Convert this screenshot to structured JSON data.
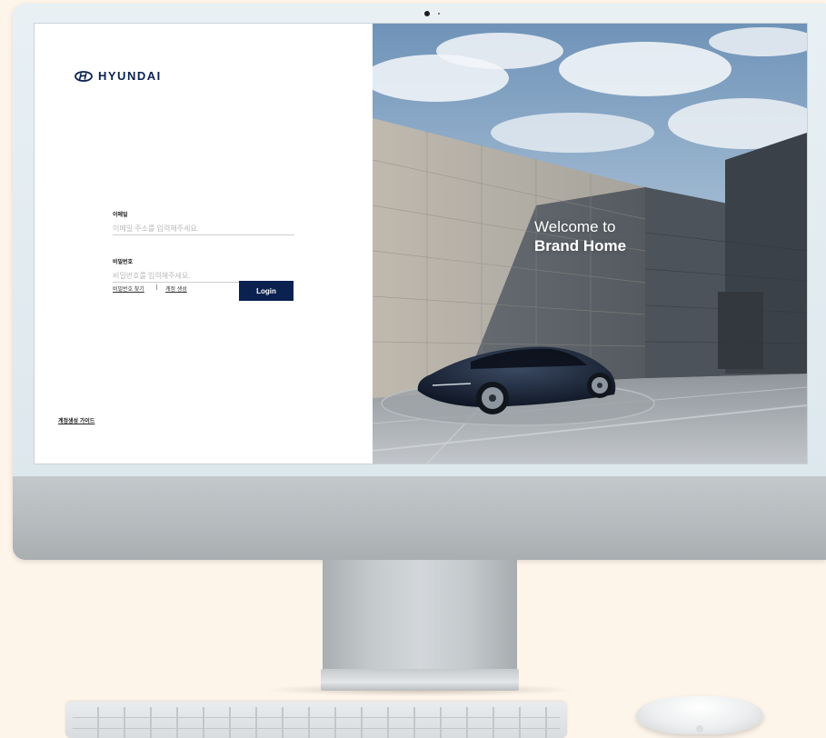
{
  "brand": {
    "name": "HYUNDAI",
    "logo_icon": "hyundai-emblem-icon",
    "color": "#0b2250"
  },
  "login_form": {
    "email_label": "이메일",
    "email_placeholder": "이메일 주소를 입력해주세요.",
    "password_label": "비밀번호",
    "password_placeholder": "비밀번호를 입력해주세요.",
    "find_password_link": "비밀번호 찾기",
    "create_account_link": "계정 생성",
    "login_button": "Login",
    "account_guide_link": "계정생성 가이드"
  },
  "hero": {
    "line1": "Welcome to",
    "line2": "Brand Home"
  },
  "colors": {
    "background": "#fdf4ea",
    "accent": "#0b2250"
  }
}
